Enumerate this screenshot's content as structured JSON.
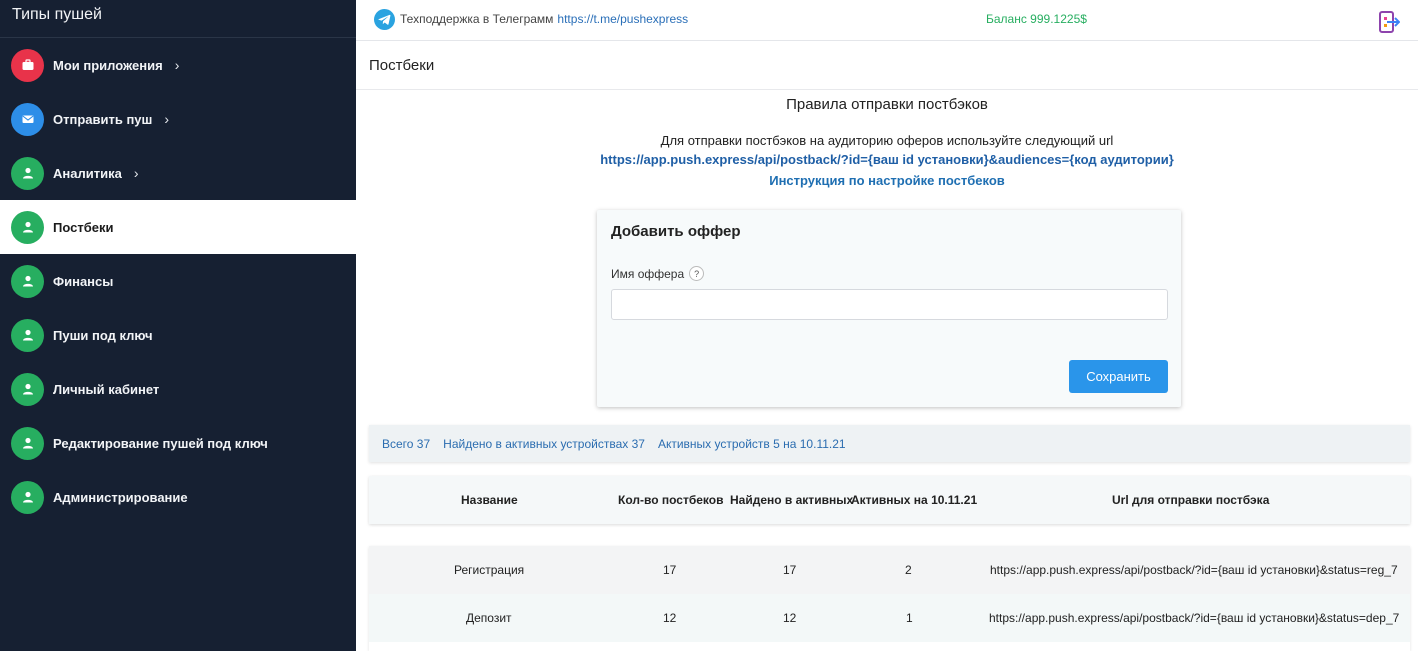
{
  "sidebar": {
    "title": "Типы пушей",
    "items": [
      {
        "label": "Мои приложения",
        "chevron": "›",
        "color": "#e8334a",
        "icon": "briefcase-icon"
      },
      {
        "label": "Отправить пуш",
        "chevron": "›",
        "color": "#2d8ee8",
        "icon": "envelope-icon"
      },
      {
        "label": "Аналитика",
        "chevron": "›",
        "color": "#27ae60",
        "icon": "user-icon"
      },
      {
        "label": "Постбеки",
        "chevron": "",
        "color": "#27ae60",
        "icon": "user-icon"
      },
      {
        "label": "Финансы",
        "chevron": "",
        "color": "#27ae60",
        "icon": "user-icon"
      },
      {
        "label": "Пуши под ключ",
        "chevron": "",
        "color": "#27ae60",
        "icon": "user-icon"
      },
      {
        "label": "Личный кабинет",
        "chevron": "",
        "color": "#27ae60",
        "icon": "user-icon"
      },
      {
        "label": "Редактирование пушей под ключ",
        "chevron": "",
        "color": "#27ae60",
        "icon": "user-icon"
      },
      {
        "label": "Администрирование",
        "chevron": "",
        "color": "#27ae60",
        "icon": "user-icon"
      }
    ]
  },
  "topbar": {
    "support_text": "Техподдержка в Телеграмм",
    "support_link": "https://t.me/pushexpress",
    "balance": "Баланс 999.1225$"
  },
  "page": {
    "title": "Постбеки"
  },
  "rules": {
    "title": "Правила отправки постбэков",
    "description": "Для отправки постбэков на аудиторию оферов используйте следующий url",
    "url": "https://app.push.express/api/postback/?id={ваш id установки}&audiences={код аудитории}",
    "instruction_link": "Инструкция по настройке постбеков"
  },
  "offer_form": {
    "title": "Добавить оффер",
    "name_label": "Имя оффера",
    "help": "?",
    "name_value": "",
    "save_label": "Сохранить"
  },
  "stats": {
    "total": "Всего 37",
    "found_active": "Найдено в активных устройствах 37",
    "active_devices": "Активных устройств 5 на 10.11.21"
  },
  "table": {
    "headers": {
      "name": "Название",
      "count": "Кол-во постбеков",
      "found": "Найдено в активных",
      "active": "Активных на 10.11.21",
      "url": "Url для отправки постбэка"
    },
    "rows": [
      {
        "name": "Регистрация",
        "count": "17",
        "found": "17",
        "active": "2",
        "url": "https://app.push.express/api/postback/?id={ваш id установки}&status=reg_7"
      },
      {
        "name": "Депозит",
        "count": "12",
        "found": "12",
        "active": "1",
        "url": "https://app.push.express/api/postback/?id={ваш id установки}&status=dep_7"
      }
    ]
  }
}
